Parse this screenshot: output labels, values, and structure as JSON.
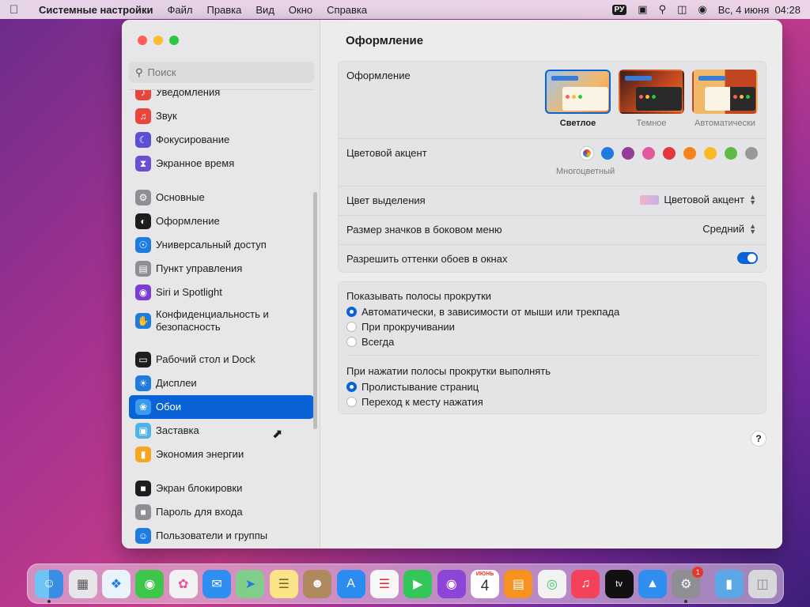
{
  "menubar": {
    "app_name": "Системные настройки",
    "menus": [
      "Файл",
      "Правка",
      "Вид",
      "Окно",
      "Справка"
    ],
    "input_lang": "РУ",
    "datetime": "Вс, 4 июня  04:28"
  },
  "sidebar": {
    "search_placeholder": "Поиск",
    "groups": [
      [
        {
          "label": "Уведомления",
          "icon": "bell-icon",
          "color": "#e8453c"
        },
        {
          "label": "Звук",
          "icon": "speaker-icon",
          "color": "#e8453c"
        },
        {
          "label": "Фокусирование",
          "icon": "moon-icon",
          "color": "#5b4fd4"
        },
        {
          "label": "Экранное время",
          "icon": "hourglass-icon",
          "color": "#6a4fcf"
        }
      ],
      [
        {
          "label": "Основные",
          "icon": "gear-icon",
          "color": "#8e8e93"
        },
        {
          "label": "Оформление",
          "icon": "appearance-icon",
          "color": "#1d1d1f"
        },
        {
          "label": "Универсальный доступ",
          "icon": "accessibility-icon",
          "color": "#1e7be0"
        },
        {
          "label": "Пункт управления",
          "icon": "control-center-icon",
          "color": "#8e8e93"
        },
        {
          "label": "Siri и Spotlight",
          "icon": "siri-icon",
          "color": "#7d3bd6"
        },
        {
          "label": "Конфиденциальность и безопасность",
          "icon": "hand-icon",
          "color": "#1e7be0"
        }
      ],
      [
        {
          "label": "Рабочий стол и Dock",
          "icon": "dock-icon",
          "color": "#1d1d1f"
        },
        {
          "label": "Дисплеи",
          "icon": "display-icon",
          "color": "#1e7be0"
        },
        {
          "label": "Обои",
          "icon": "wallpaper-icon",
          "color": "#3a9af0",
          "active": true
        },
        {
          "label": "Заставка",
          "icon": "screensaver-icon",
          "color": "#4fb3e8"
        },
        {
          "label": "Экономия энергии",
          "icon": "battery-icon",
          "color": "#f5a623"
        }
      ],
      [
        {
          "label": "Экран блокировки",
          "icon": "lock-icon",
          "color": "#1d1d1f"
        },
        {
          "label": "Пароль для входа",
          "icon": "password-lock-icon",
          "color": "#8e8e93"
        },
        {
          "label": "Пользователи и группы",
          "icon": "users-icon",
          "color": "#1e7be0"
        }
      ]
    ]
  },
  "content": {
    "title": "Оформление",
    "appearance": {
      "label": "Оформление",
      "options": [
        {
          "label": "Светлое",
          "selected": true
        },
        {
          "label": "Темное",
          "selected": false
        },
        {
          "label": "Автоматически",
          "selected": false
        }
      ]
    },
    "accent": {
      "label": "Цветовой акцент",
      "caption": "Многоцветный",
      "colors": [
        "multicolor",
        "#1e7be0",
        "#953d96",
        "#e5579d",
        "#e0383e",
        "#f7821b",
        "#fcb827",
        "#62ba46",
        "#989898"
      ]
    },
    "highlight": {
      "label": "Цвет выделения",
      "value": "Цветовой акцент"
    },
    "icon_size": {
      "label": "Размер значков в боковом меню",
      "value": "Средний"
    },
    "wallpaper_tint": {
      "label": "Разрешить оттенки обоев в окнах",
      "enabled": true
    },
    "scrollbars": {
      "label": "Показывать полосы прокрутки",
      "options": [
        {
          "label": "Автоматически, в зависимости от мыши или трекпада",
          "selected": true
        },
        {
          "label": "При прокручивании",
          "selected": false
        },
        {
          "label": "Всегда",
          "selected": false
        }
      ]
    },
    "click_scroll": {
      "label": "При нажатии полосы прокрутки выполнять",
      "options": [
        {
          "label": "Пролистывание страниц",
          "selected": true
        },
        {
          "label": "Переход к месту нажатия",
          "selected": false
        }
      ]
    },
    "help": "?"
  },
  "dock": {
    "calendar_month": "ИЮНЬ",
    "calendar_day": "4",
    "settings_badge": "1"
  }
}
